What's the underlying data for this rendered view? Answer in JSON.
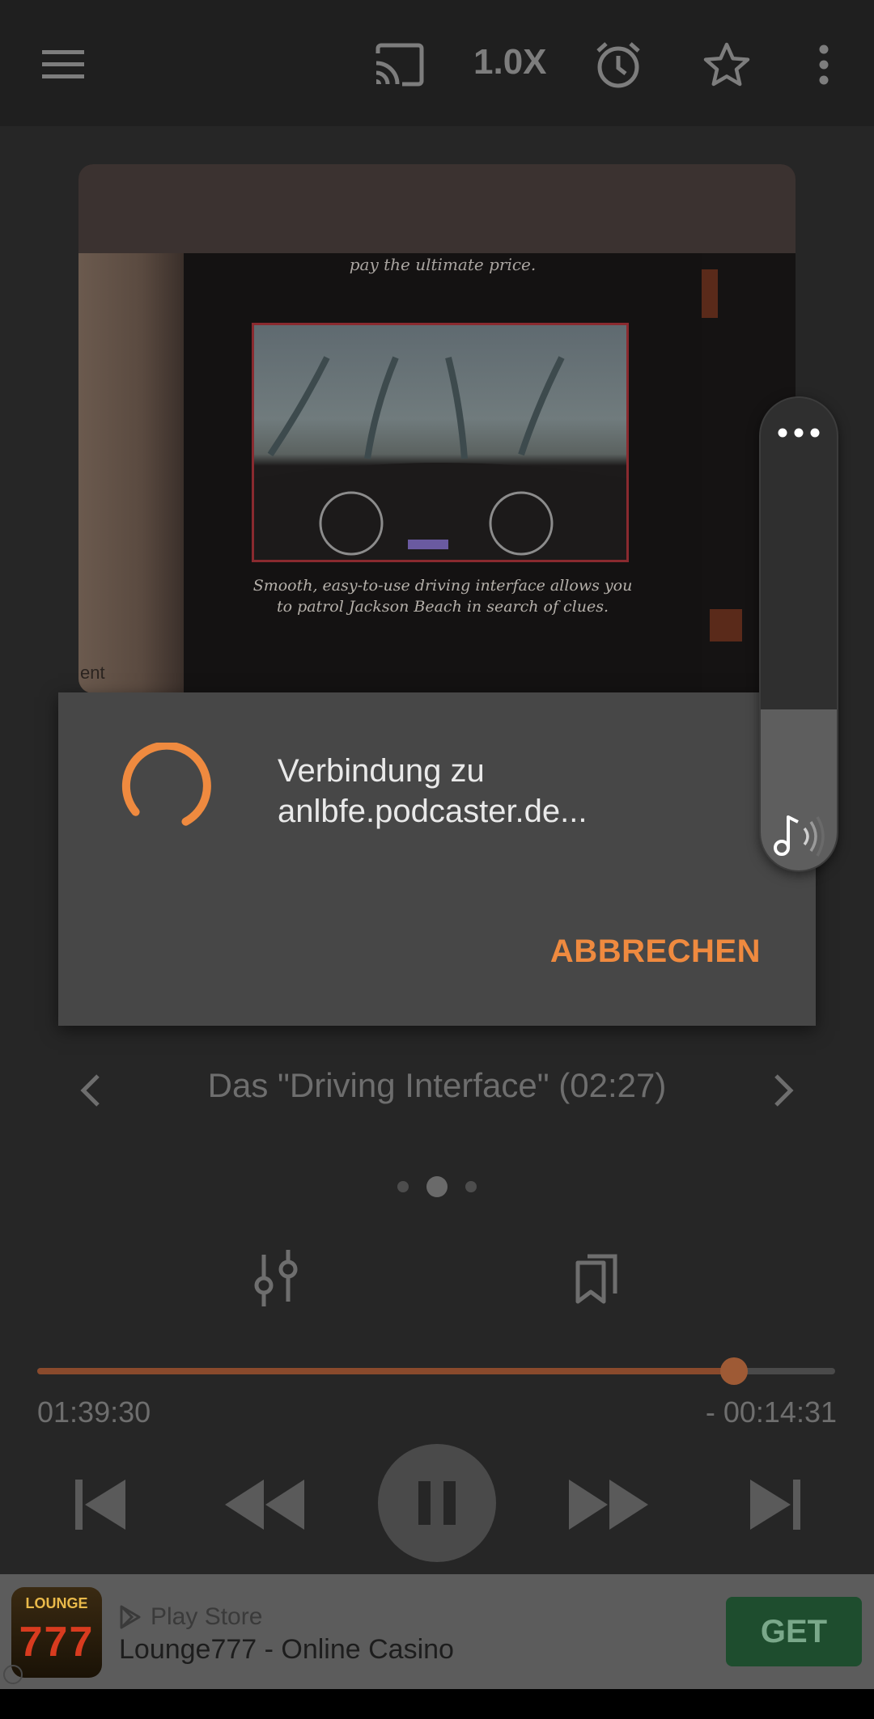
{
  "toolbar": {
    "speed": "1.0X",
    "icons": [
      "menu-icon",
      "cast-icon",
      "alarm-icon",
      "star-icon",
      "more-vert-icon"
    ]
  },
  "cover": {
    "caption_top": "pay the ultimate price.",
    "caption_bottom_line1": "Smooth, easy-to-use driving interface allows you",
    "caption_bottom_line2": "to patrol Jackson Beach in search of clues.",
    "side_text": "ent\na\n\nley"
  },
  "chapter": {
    "title": "Das \"Driving Interface\" (02:27)"
  },
  "pager": {
    "count": 3,
    "active": 1
  },
  "playback": {
    "elapsed": "01:39:30",
    "remaining": "- 00:14:31",
    "progress": 0.873
  },
  "dialog": {
    "message": "Verbindung zu anlbfe.podcaster.de...",
    "cancel_label": "ABBRECHEN"
  },
  "volume": {
    "level": 0.34
  },
  "ad": {
    "icon_word": "LOUNGE",
    "icon_number": "777",
    "source": "Play Store",
    "title": "Lounge777 - Online Casino",
    "cta": "GET"
  },
  "colors": {
    "accent": "#ef8a3f",
    "background": "#262626",
    "dialog": "#474747"
  }
}
